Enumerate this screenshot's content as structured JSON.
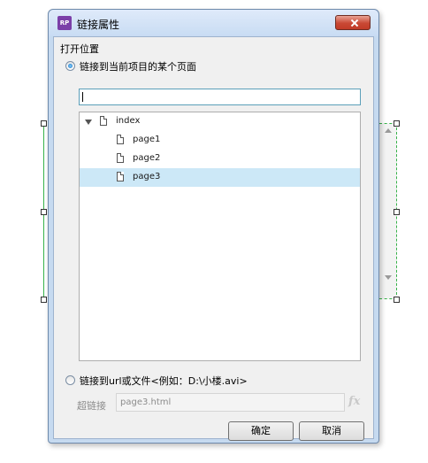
{
  "window": {
    "title": "链接属性",
    "app_icon_text": "RP"
  },
  "open_position": {
    "label": "打开位置"
  },
  "option_page": {
    "label": "链接到当前项目的某个页面",
    "checked": true,
    "search_value": ""
  },
  "tree": {
    "root": {
      "label": "index",
      "expanded": true
    },
    "children": [
      {
        "label": "page1",
        "selected": false
      },
      {
        "label": "page2",
        "selected": false
      },
      {
        "label": "page3",
        "selected": true
      }
    ]
  },
  "option_url": {
    "label": "链接到url或文件<例如：D:\\小楼.avi>",
    "checked": false
  },
  "hyperlink": {
    "label": "超链接",
    "value": "page3.html",
    "fx_label": "fx"
  },
  "buttons": {
    "ok": "确定",
    "cancel": "取消"
  },
  "colors": {
    "selection": "#cce8f7",
    "widget_outline": "#37b34a",
    "close_button": "#c94834"
  }
}
